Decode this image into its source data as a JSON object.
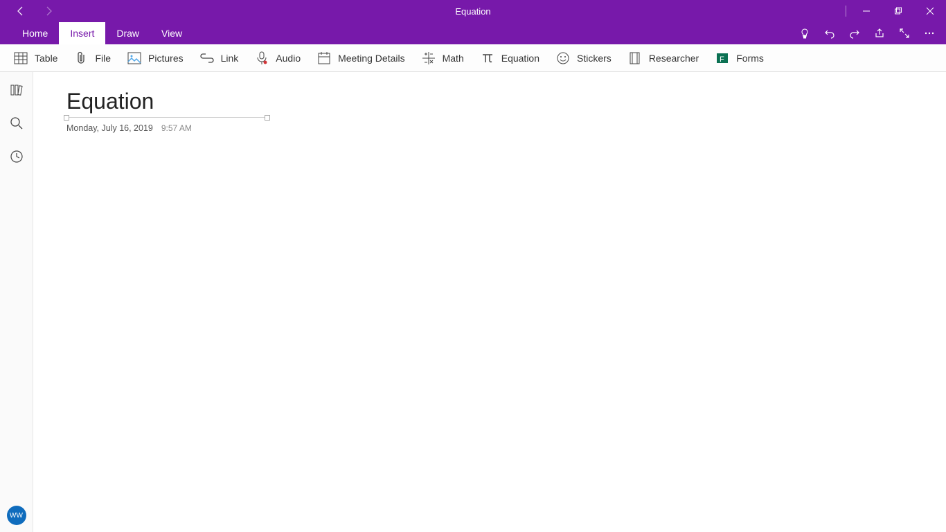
{
  "window": {
    "title": "Equation"
  },
  "tabs": [
    {
      "label": "Home"
    },
    {
      "label": "Insert"
    },
    {
      "label": "Draw"
    },
    {
      "label": "View"
    }
  ],
  "active_tab": 1,
  "ribbon": {
    "table": "Table",
    "file": "File",
    "pictures": "Pictures",
    "link": "Link",
    "audio": "Audio",
    "meeting": "Meeting Details",
    "math": "Math",
    "equation": "Equation",
    "stickers": "Stickers",
    "researcher": "Researcher",
    "forms": "Forms"
  },
  "page": {
    "title": "Equation",
    "date": "Monday, July 16, 2019",
    "time": "9:57 AM"
  },
  "avatar": {
    "initials": "WW"
  }
}
